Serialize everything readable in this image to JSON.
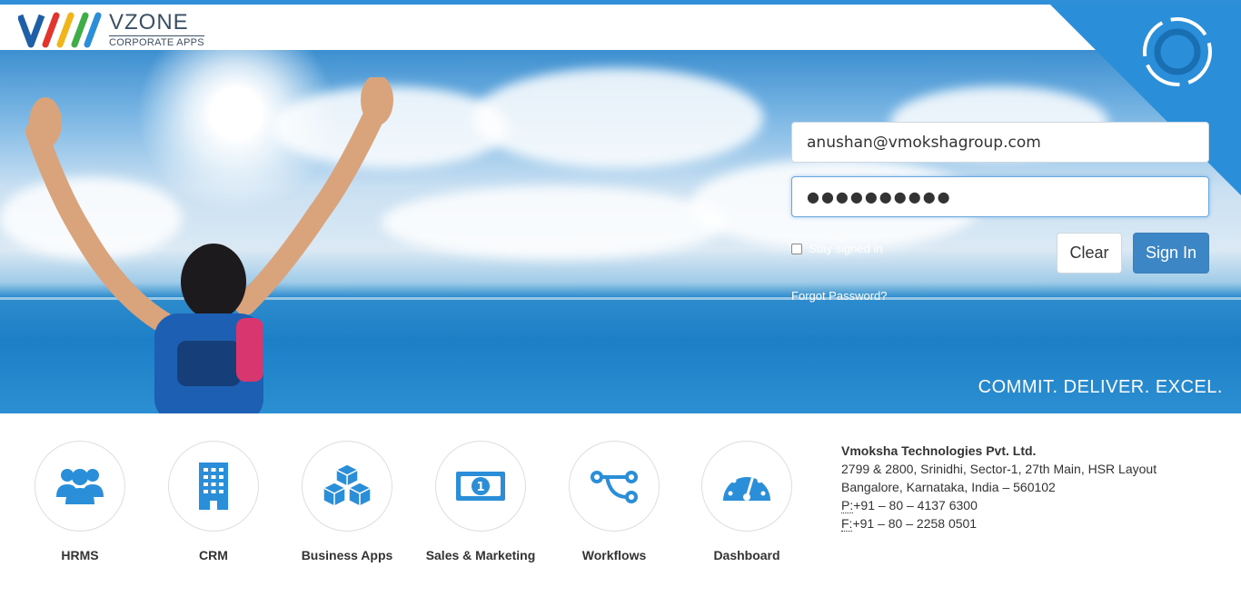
{
  "header": {
    "logo_title": "VZONE",
    "logo_subtitle": "CORPORATE APPS"
  },
  "login": {
    "email_value": "anushan@vmokshagroup.com",
    "password_masked": "●●●●●●●●●●",
    "stay_signed_in_label": "Stay signed in",
    "stay_signed_in_checked": false,
    "clear_label": "Clear",
    "signin_label": "Sign In",
    "forgot_password_label": "Forgot Password?"
  },
  "hero": {
    "tagline": "COMMIT. DELIVER. EXCEL."
  },
  "apps": [
    {
      "label": "HRMS",
      "icon": "users-icon"
    },
    {
      "label": "CRM",
      "icon": "building-icon"
    },
    {
      "label": "Business Apps",
      "icon": "cubes-icon"
    },
    {
      "label": "Sales & Marketing",
      "icon": "money-icon"
    },
    {
      "label": "Workflows",
      "icon": "workflow-icon"
    },
    {
      "label": "Dashboard",
      "icon": "dashboard-icon"
    }
  ],
  "company": {
    "name": "Vmoksha Technologies Pvt. Ltd.",
    "address_line1": "2799 & 2800, Srinidhi, Sector-1, 27th Main, HSR Layout",
    "address_line2": "Bangalore, Karnataka, India – 560102",
    "phone_prefix": "P:",
    "phone": "+91 – 80 – 4137 6300",
    "fax_prefix": "F:",
    "fax": "+91 – 80 – 2258 0501"
  },
  "colors": {
    "accent": "#2f8fd8",
    "signin_button": "#3d86c6",
    "icon_blue": "#2a8fd8"
  }
}
